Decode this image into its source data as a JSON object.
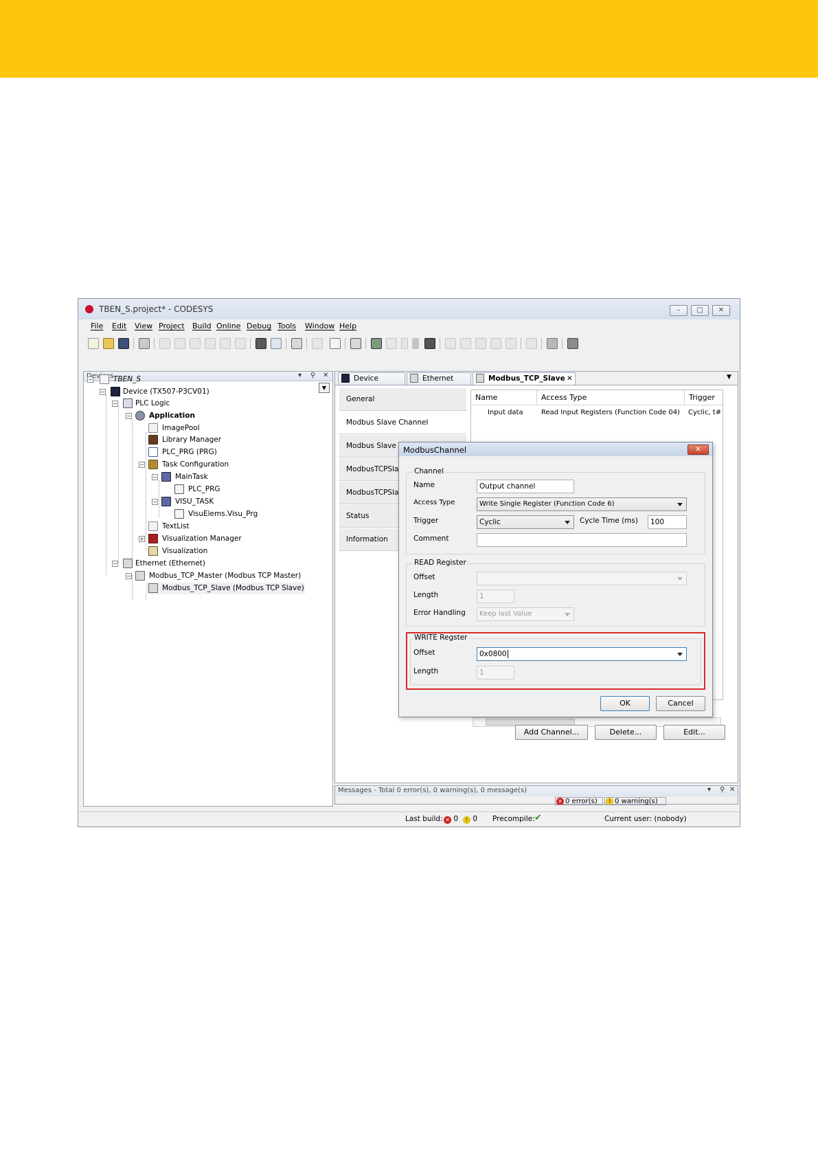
{
  "window": {
    "title": "TBEN_S.project* - CODESYS",
    "controls": [
      "–",
      "□",
      "✕"
    ]
  },
  "menu": [
    "File",
    "Edit",
    "View",
    "Project",
    "Build",
    "Online",
    "Debug",
    "Tools",
    "Window",
    "Help"
  ],
  "devices_pane": {
    "title": "Devices",
    "tree": [
      {
        "label": "TBEN_S",
        "icon": "project-icon"
      },
      {
        "label": "Device (TX507-P3CV01)",
        "icon": "device-icon"
      },
      {
        "label": "PLC Logic",
        "icon": "plc-logic-icon"
      },
      {
        "label": "Application",
        "icon": "application-icon"
      },
      {
        "label": "ImagePool",
        "icon": "imagepool-icon"
      },
      {
        "label": "Library Manager",
        "icon": "library-icon"
      },
      {
        "label": "PLC_PRG (PRG)",
        "icon": "program-icon"
      },
      {
        "label": "Task Configuration",
        "icon": "task-config-icon"
      },
      {
        "label": "MainTask",
        "icon": "task-icon"
      },
      {
        "label": "PLC_PRG",
        "icon": "program-call-icon"
      },
      {
        "label": "VISU_TASK",
        "icon": "task-icon"
      },
      {
        "label": "VisuElems.Visu_Prg",
        "icon": "program-call-icon"
      },
      {
        "label": "TextList",
        "icon": "textlist-icon"
      },
      {
        "label": "Visualization Manager",
        "icon": "visu-manager-icon"
      },
      {
        "label": "Visualization",
        "icon": "visualization-icon"
      },
      {
        "label": "Ethernet (Ethernet)",
        "icon": "ethernet-icon"
      },
      {
        "label": "Modbus_TCP_Master (Modbus TCP Master)",
        "icon": "modbus-master-icon"
      },
      {
        "label": "Modbus_TCP_Slave (Modbus TCP Slave)",
        "icon": "modbus-slave-icon"
      }
    ]
  },
  "editor": {
    "tabs": [
      "Device",
      "Ethernet",
      "Modbus_TCP_Slave"
    ],
    "side_tabs": [
      "General",
      "Modbus Slave Channel",
      "Modbus Slave In",
      "ModbusTCPSlave",
      "ModbusTCPSlave",
      "Status",
      "Information"
    ],
    "grid": {
      "columns": [
        "Name",
        "Access Type",
        "Trigger"
      ],
      "rows": [
        {
          "name": "Input data",
          "access": "Read Input Registers (Function Code 04)",
          "trigger": "Cyclic, t#"
        }
      ]
    },
    "buttons": {
      "add": "Add Channel...",
      "delete": "Delete...",
      "edit": "Edit..."
    }
  },
  "messages": {
    "title": "Messages - Total 0 error(s), 0 warning(s), 0 message(s)",
    "errors": "0 error(s)",
    "warnings": "0 warning(s)"
  },
  "statusbar": {
    "last_build_label": "Last build:",
    "errors": "0",
    "warnings": "0",
    "precompile_label": "Precompile:",
    "user": "Current user: (nobody)"
  },
  "dialog": {
    "title": "ModbusChannel",
    "channel": {
      "group": "Channel",
      "name_label": "Name",
      "name_value": "Output channel",
      "access_label": "Access Type",
      "access_value": "Write Single Register (Function Code 6)",
      "trigger_label": "Trigger",
      "trigger_value": "Cyclic",
      "cycle_label": "Cycle Time (ms)",
      "cycle_value": "100",
      "comment_label": "Comment",
      "comment_value": ""
    },
    "read": {
      "group": "READ Register",
      "offset_label": "Offset",
      "offset_value": "",
      "length_label": "Length",
      "length_value": "1",
      "error_label": "Error Handling",
      "error_value": "Keep last Value"
    },
    "write": {
      "group": "WRITE Regster",
      "offset_label": "Offset",
      "offset_value": "0x0800",
      "length_label": "Length",
      "length_value": "1"
    },
    "ok": "OK",
    "cancel": "Cancel"
  },
  "colors": {
    "banner": "#fdc70c",
    "highlight": "#d62b2b"
  }
}
